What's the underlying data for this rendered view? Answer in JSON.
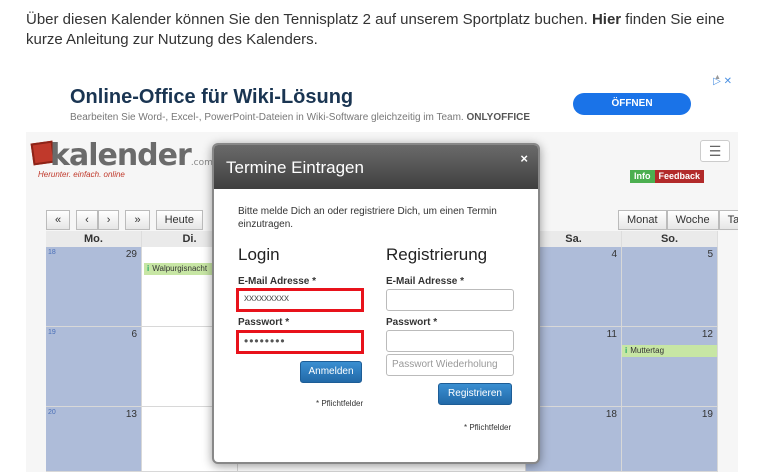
{
  "intro": {
    "before": "Über diesen Kalender können Sie den Tennisplatz 2 auf unserem Sportplatz buchen. ",
    "bold": "Hier",
    "after": " finden Sie eine kurze Anleitung zur Nutzung des Kalenders."
  },
  "ad": {
    "title": "Online-Office für Wiki-Lösung",
    "subtitle": "Bearbeiten Sie Word-, Excel-, PowerPoint-Dateien in Wiki-Software gleichzeitig im Team.",
    "brand": "ONLYOFFICE",
    "button": "ÖFFNEN",
    "close": "▷ ✕"
  },
  "calendar": {
    "logo": "kalender",
    "logo_suffix": ".com",
    "tagline": "Herunter. einfach. online",
    "menu_icon": "hamburger-icon",
    "info": "Info",
    "feedback": "Feedback",
    "nav": {
      "first": "«",
      "prev": "‹",
      "next": "›",
      "last": "»",
      "today": "Heute"
    },
    "views": [
      "Monat",
      "Woche",
      "Tag"
    ],
    "columns": [
      "Mo.",
      "Di.",
      "Sa.",
      "So."
    ],
    "weeks": [
      {
        "wk": "18",
        "mo": "29",
        "sa": "4",
        "so": "5"
      },
      {
        "wk": "19",
        "mo": "6",
        "sa": "11",
        "so": "12"
      },
      {
        "wk": "20",
        "mo": "13",
        "sa": "18",
        "so": "19"
      }
    ],
    "events": {
      "walpurgis": "Walpurgisnacht",
      "muttertag": "Muttertag"
    }
  },
  "modal": {
    "title": "Termine Eintragen",
    "close": "×",
    "intro": "Bitte melde Dich an oder registriere Dich, um einen Termin einzutragen.",
    "login": {
      "title": "Login",
      "email_label": "E-Mail Adresse *",
      "email_value": "xxxxxxxxx",
      "password_label": "Passwort *",
      "password_value": "••••••••",
      "button": "Anmelden",
      "required": "* Pflichtfelder"
    },
    "register": {
      "title": "Registrierung",
      "email_label": "E-Mail Adresse *",
      "password_label": "Passwort *",
      "repeat_placeholder": "Passwort Wiederholung",
      "button": "Registrieren",
      "required": "* Pflichtfelder"
    }
  },
  "colors": {
    "highlight": "#e8121b",
    "button": "#2a78c0",
    "week_blue": "#aebcd9"
  }
}
